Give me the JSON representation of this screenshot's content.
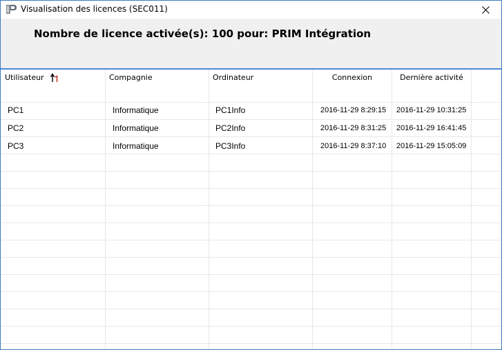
{
  "window": {
    "title": "Visualisation des licences (SEC011)"
  },
  "header": {
    "summary": "Nombre de licence activée(s): 100 pour: PRIM Intégration"
  },
  "grid": {
    "columns": [
      {
        "id": "utilisateur",
        "label": "Utilisateur",
        "sorted": "ascending"
      },
      {
        "id": "compagnie",
        "label": "Compagnie"
      },
      {
        "id": "ordinateur",
        "label": "Ordinateur"
      },
      {
        "id": "connexion",
        "label": "Connexion"
      },
      {
        "id": "derniere_activite",
        "label": "Dernière activité"
      }
    ],
    "rows": [
      {
        "utilisateur": "PC1",
        "compagnie": "Informatique",
        "ordinateur": "PC1Info",
        "connexion": "2016-11-29 8:29:15",
        "derniere_activite": "2016-11-29 10:31:25"
      },
      {
        "utilisateur": "PC2",
        "compagnie": "Informatique",
        "ordinateur": "PC2Info",
        "connexion": "2016-11-29 8:31:25",
        "derniere_activite": "2016-11-29 16:41:45"
      },
      {
        "utilisateur": "PC3",
        "compagnie": "Informatique",
        "ordinateur": "PC3Info",
        "connexion": "2016-11-29 8:37:10",
        "derniere_activite": "2016-11-29 15:05:09"
      }
    ]
  },
  "icons": {
    "app": "prim-logo-icon",
    "close": "close-icon",
    "sort": "sort-ascending-icon"
  },
  "colors": {
    "window_border": "#3d7bc4",
    "header_bg": "#f0f0f0",
    "header_underline": "#4a8ad4",
    "sort_accent": "#c0392b"
  }
}
